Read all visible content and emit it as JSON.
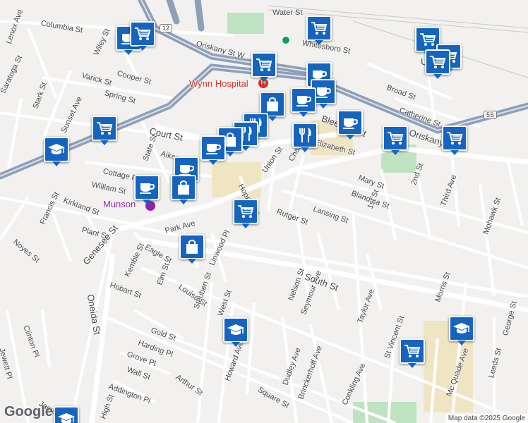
{
  "map": {
    "hospital_label": "Wynn Hospital",
    "munson_label": "Munson",
    "route_shield": "12",
    "route_shield_5s": "5S",
    "google_logo": "Google",
    "attribution": "Map data ©2025 Google"
  },
  "colors": {
    "marker": "#1565c0",
    "highway": "#8ea0b8",
    "park": "#bfe3c0",
    "campus": "#f0e5c3",
    "hospital_text": "#d93025",
    "munson_text": "#8e24aa"
  },
  "streets": [
    "Water St",
    "Columbia St",
    "Lenox Ave",
    "Wiley St",
    "Oriskany St W",
    "Whitesboro St",
    "Varick St",
    "Cooper St",
    "Saratoga St",
    "Spring St",
    "Stark St",
    "Sunset Ave",
    "Court St",
    "Aiken St",
    "State St",
    "Cottage Pl",
    "William St",
    "Kirkland St",
    "Francis St",
    "Plant St",
    "Noyes St",
    "Park Ave",
    "Elm St",
    "Linwood Pl",
    "Eagle St",
    "Kemble St",
    "Genesee St",
    "Oneida St",
    "Hobart St",
    "Louisa St",
    "Steuben St",
    "West St",
    "Clinton Pl",
    "Jewett Pl",
    "Gold St",
    "Harding Pl",
    "Grove Pl",
    "Wall St",
    "Addington Pl",
    "Arthur St",
    "High St",
    "James St",
    "Howard Ave",
    "Square St",
    "Dudley Ave",
    "Brinckerhoff Ave",
    "Conkling Ave",
    "Nelson St",
    "Seymour Ave",
    "Taylor Ave",
    "South St",
    "Rutger St",
    "Lansing St",
    "Blandina St",
    "Mary St",
    "1st St",
    "2nd St",
    "Third Ave",
    "Mohawk St",
    "Morris St",
    "Leeds St",
    "Mc Quade Ave",
    "St Vincent St",
    "George St",
    "Hopper St",
    "Union St",
    "Charlotte St",
    "Broad St",
    "Catherine St",
    "Bleecker St",
    "Oriskany St",
    "Utica",
    "Elizabeth St"
  ],
  "markers": [
    {
      "type": "cafe"
    },
    {
      "type": "grocery"
    },
    {
      "type": "grocery"
    },
    {
      "type": "grocery"
    },
    {
      "type": "grocery"
    },
    {
      "type": "grocery"
    },
    {
      "type": "cafe"
    },
    {
      "type": "cafe"
    },
    {
      "type": "cafe"
    },
    {
      "type": "shopping"
    },
    {
      "type": "cafe"
    },
    {
      "type": "grocery"
    },
    {
      "type": "restaurant"
    },
    {
      "type": "restaurant"
    },
    {
      "type": "shopping"
    },
    {
      "type": "restaurant"
    },
    {
      "type": "cafe"
    },
    {
      "type": "cafe"
    },
    {
      "type": "shopping"
    },
    {
      "type": "cafe"
    },
    {
      "type": "grocery"
    },
    {
      "type": "shopping"
    },
    {
      "type": "school"
    },
    {
      "type": "grocery"
    },
    {
      "type": "grocery"
    },
    {
      "type": "grocery"
    },
    {
      "type": "school"
    },
    {
      "type": "school"
    },
    {
      "type": "school"
    },
    {
      "type": "grocery"
    }
  ]
}
